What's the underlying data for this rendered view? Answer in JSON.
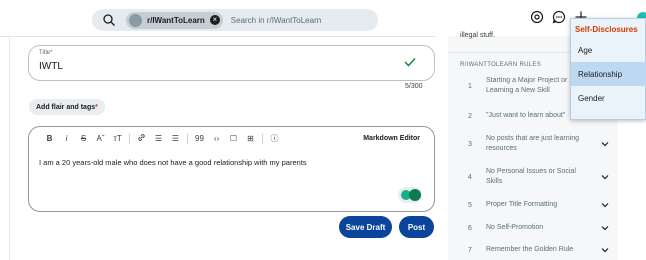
{
  "search": {
    "community_chip": "r/IWantToLearn",
    "placeholder": "Search in r/IWantToLearn"
  },
  "post_form": {
    "title_label": "Title*",
    "title_value": "IWTL",
    "char_counter": "5/300",
    "flair_button_label": "Add flair and tags",
    "flair_required_mark": "*",
    "markdown_editor_label": "Markdown Editor",
    "body_text": "I am a 20 years-old male who does not have a good relationship with my parents",
    "save_draft_label": "Save Draft",
    "post_label": "Post",
    "toolbar": [
      "B",
      "i",
      "S",
      "Aˆ",
      "тT",
      "🔗",
      "☰",
      "☰",
      "99",
      "‹›",
      "☐",
      "⊞",
      "ⓘ"
    ]
  },
  "sidebar": {
    "legal_text": "illegal stuff.",
    "rules_header": "R/IWANTTOLEARN RULES",
    "rules": [
      {
        "num": "1",
        "label": "Starting a Major Project or Learning a New Skill"
      },
      {
        "num": "2",
        "label": "\"Just want to learn about\""
      },
      {
        "num": "3",
        "label": "No posts that are just learning resources"
      },
      {
        "num": "4",
        "label": "No Personal Issues or Social Skills"
      },
      {
        "num": "5",
        "label": "Proper Title Formatting"
      },
      {
        "num": "6",
        "label": "No Self-Promotion"
      },
      {
        "num": "7",
        "label": "Remember the Golden Rule"
      }
    ]
  },
  "dropdown": {
    "header": "Self-Disclosures",
    "options": [
      "Age",
      "Relationship",
      "Gender"
    ],
    "selected": "Relationship"
  },
  "colors": {
    "primary_button": "#0a449b",
    "dropdown_header": "#d93a00",
    "dropdown_selected": "#bfd8f2",
    "check": "#1a8b3d"
  }
}
